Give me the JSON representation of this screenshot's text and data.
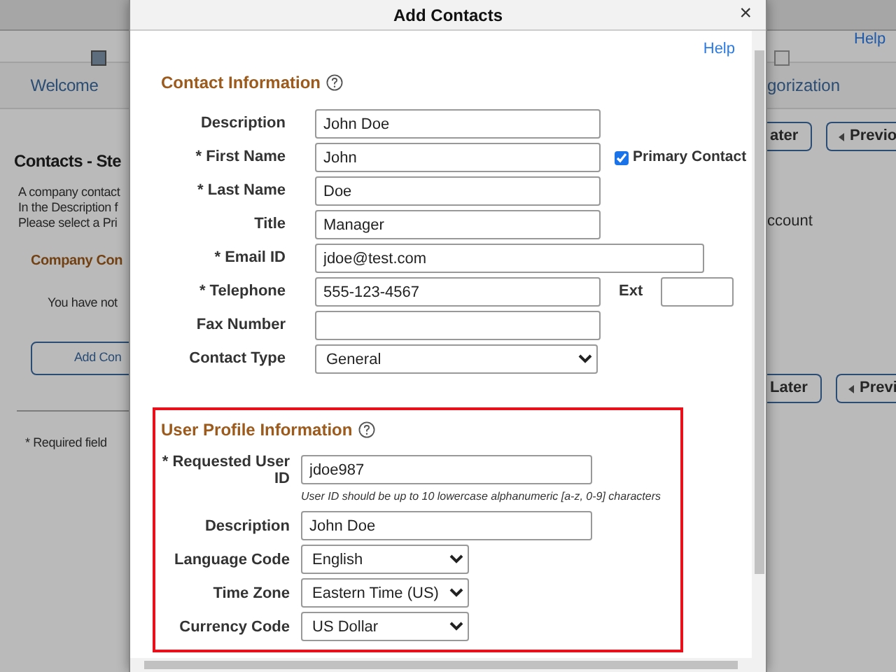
{
  "background_page": {
    "left": {
      "step_label": "Welcome",
      "heading": "Contacts - Ste",
      "intro_lines": [
        "A company contact",
        "In the Description f",
        "Please select a Pri"
      ],
      "section_title": "Company Con",
      "empty_text": "You have not",
      "add_button": "Add Con",
      "required_note": "* Required field"
    },
    "right": {
      "help": "Help",
      "step_label": "gorization",
      "later_top": "ater",
      "previous_top": "Previo",
      "intro_end": "ccount",
      "later_bottom": "Later",
      "previous_bottom": "Previ"
    }
  },
  "dialog": {
    "title": "Add Contacts",
    "close": "×",
    "help": "Help",
    "contact_section": {
      "title": "Contact Information",
      "fields": [
        {
          "kind": "text",
          "label": "Description",
          "value": "John Doe"
        },
        {
          "kind": "text",
          "label": "* First Name",
          "value": "John",
          "checkbox": {
            "label": "Primary Contact",
            "checked": true
          }
        },
        {
          "kind": "text",
          "label": "* Last Name",
          "value": "Doe"
        },
        {
          "kind": "text",
          "label": "Title",
          "value": "Manager"
        },
        {
          "kind": "wide",
          "label": "* Email ID",
          "value": "jdoe@test.com"
        },
        {
          "kind": "text",
          "label": "* Telephone",
          "value": "555-123-4567",
          "ext": {
            "label": "Ext"
          }
        },
        {
          "kind": "text",
          "label": "Fax Number"
        },
        {
          "kind": "select",
          "label": "Contact Type",
          "value": "General"
        }
      ]
    },
    "profile_section": {
      "title": "User Profile Information",
      "highlighted": true,
      "fields": [
        {
          "kind": "text",
          "label": "* Requested User ID",
          "value": "jdoe987",
          "hint": "User ID should be up to 10 lowercase alphanumeric [a-z, 0-9] characters"
        },
        {
          "kind": "text",
          "label": "Description",
          "value": "John Doe"
        },
        {
          "kind": "select",
          "label": "Language Code",
          "value": "English"
        },
        {
          "kind": "select",
          "label": "Time Zone",
          "value": "Eastern Time (US)"
        },
        {
          "kind": "select",
          "label": "Currency Code",
          "value": "US Dollar"
        }
      ]
    }
  }
}
